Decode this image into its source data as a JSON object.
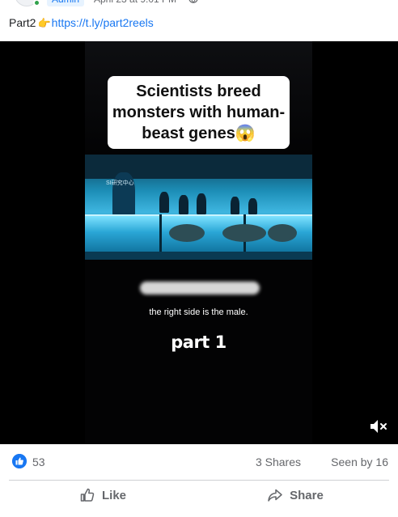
{
  "header": {
    "role_badge": "Admin",
    "post_time": "April 23 at 9:01 PM"
  },
  "post": {
    "text_prefix": "Part2",
    "hand_emoji": "👉",
    "link": "https://t.ly/part2reels"
  },
  "video": {
    "caption": "Scientists breed monsters with human-beast genes😱",
    "caption_lines": [
      "Scientists breed",
      "monsters with human-",
      "beast genes😱"
    ],
    "sign_text": "SI研究中心",
    "subtitle": "the right side is the male.",
    "part_label": "part 1",
    "mute_icon": "speaker-muted-icon"
  },
  "stats": {
    "likes": "53",
    "shares": "3 Shares",
    "seen_by": "Seen by 16"
  },
  "actions": {
    "like_label": "Like",
    "share_label": "Share"
  },
  "colors": {
    "accent": "#1877f2",
    "muted_text": "#65676b",
    "online": "#31a24c"
  }
}
